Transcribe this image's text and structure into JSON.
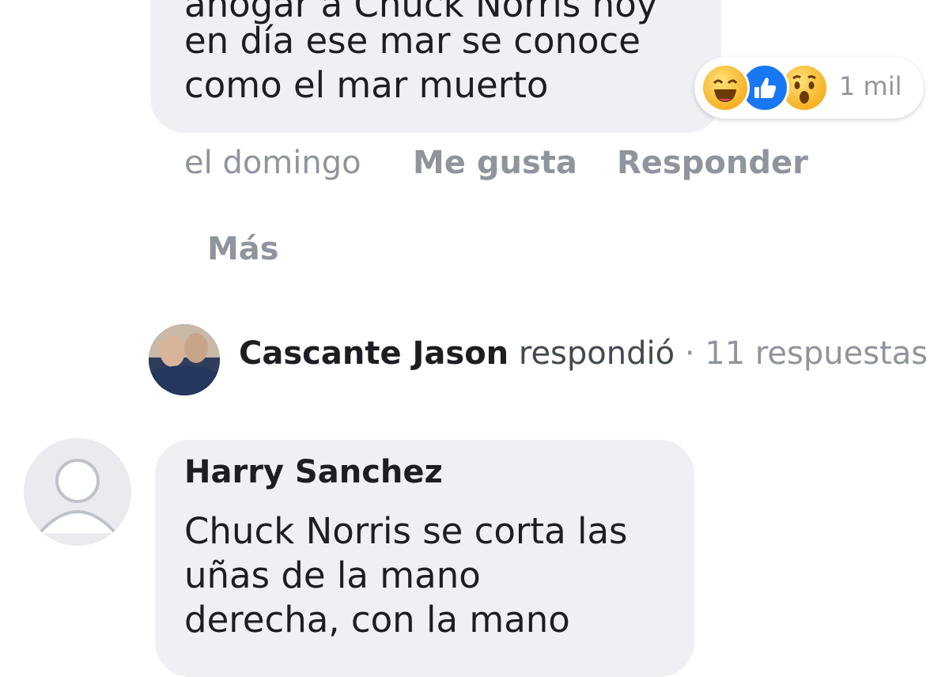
{
  "comment1": {
    "text_lines": [
      "ahogar a Chuck Norris hoy",
      "en día ese mar se conoce",
      "como el mar muerto"
    ],
    "reactions": {
      "icons": [
        "haha-icon",
        "like-icon",
        "wow-icon"
      ],
      "count": "1 mil"
    },
    "time": "el domingo",
    "like_label": "Me gusta",
    "reply_label": "Responder"
  },
  "more_label": "Más",
  "reply_summary": {
    "name": "Cascante Jason",
    "verb": "respondió",
    "count": "· 11 respuestas"
  },
  "comment2": {
    "author": "Harry Sanchez",
    "text_lines": [
      "Chuck Norris se corta las",
      "uñas de la mano",
      "derecha, con la mano"
    ]
  },
  "colors": {
    "bubble": "#eef0f3",
    "meta_text": "#90949c",
    "like_blue": "#1877f2",
    "haha_yellow": "#f7b125"
  }
}
